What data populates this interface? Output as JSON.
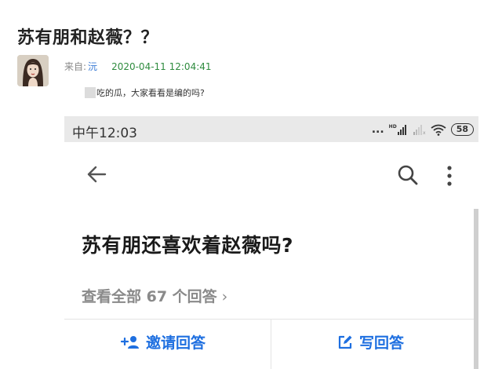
{
  "post": {
    "title": "苏有朋和赵薇？？",
    "from_label": "来自:",
    "author": "沅",
    "date": "2020-04-11 12:04:41",
    "body": "吃的瓜，大家看看是编的吗?"
  },
  "phone": {
    "status": {
      "time": "中午12:03",
      "dots": "...",
      "signal_label": "HD",
      "battery": "58"
    },
    "question": "苏有朋还喜欢着赵薇吗?",
    "view_all": "查看全部 67 个回答",
    "chevron": "›",
    "actions": {
      "invite": "邀请回答",
      "write": "写回答"
    }
  },
  "colors": {
    "accent": "#1e6fe0",
    "author_link": "#3a7bd5",
    "date": "#2e8b3e",
    "status_bar": "#e9e9e9"
  }
}
